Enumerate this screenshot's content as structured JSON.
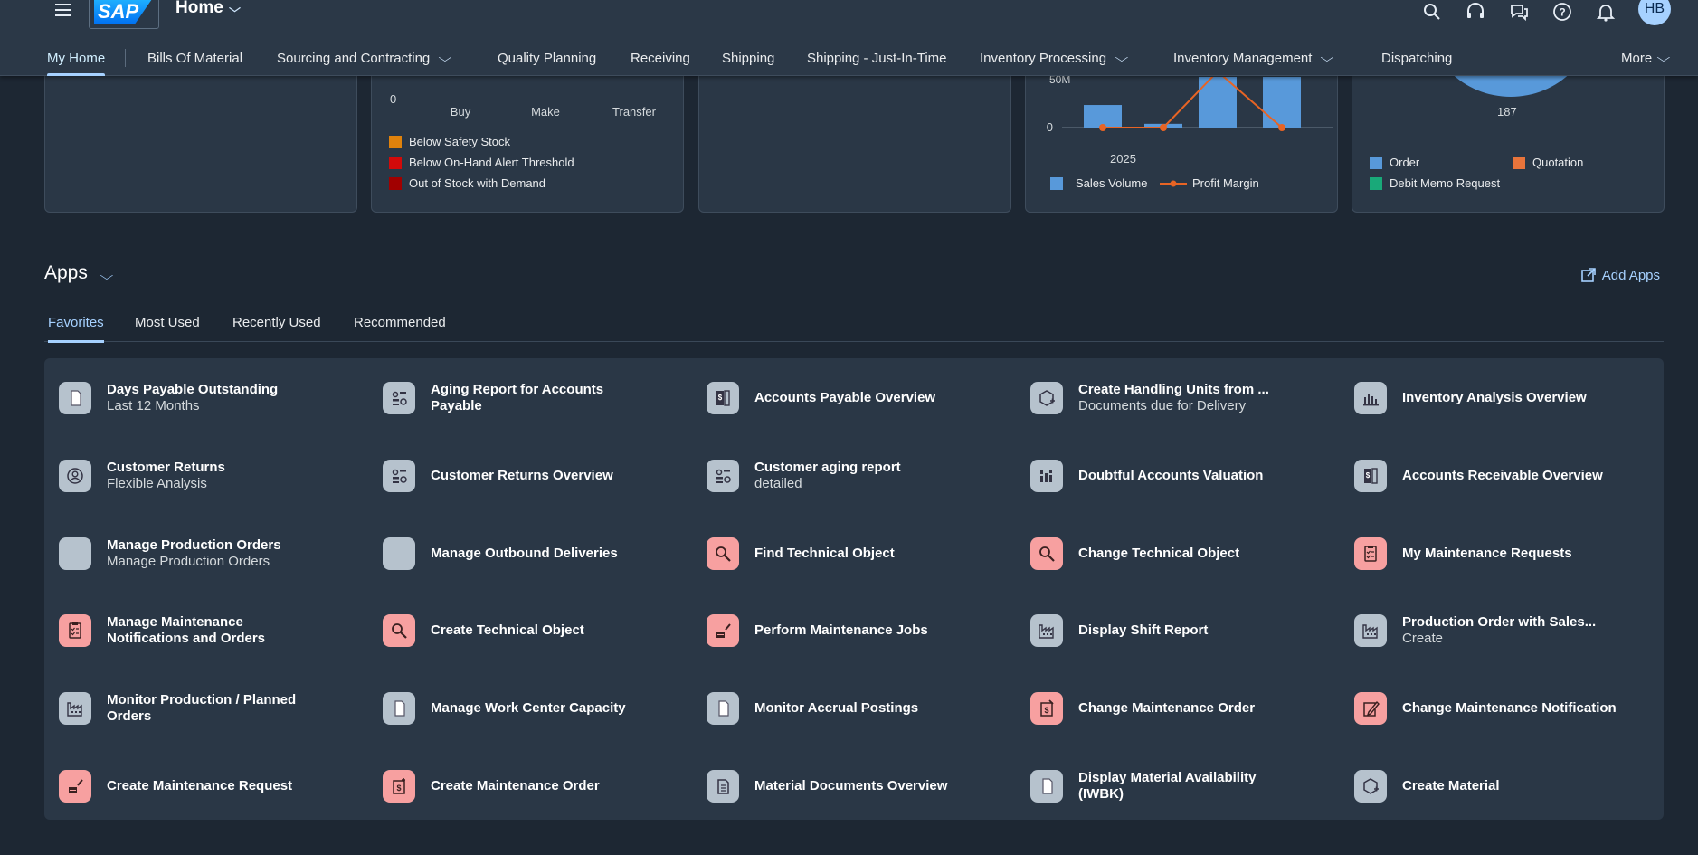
{
  "shell": {
    "logo": "SAP",
    "title": "Home",
    "avatar_initials": "HB",
    "icons": [
      "search-icon",
      "headset-icon",
      "chat-icon",
      "help-icon",
      "bell-icon"
    ]
  },
  "nav": {
    "items": [
      {
        "label": "My Home"
      },
      {
        "label": "Bills Of Material"
      },
      {
        "label": "Sourcing and Contracting"
      },
      {
        "label": "Quality Planning"
      },
      {
        "label": "Receiving"
      },
      {
        "label": "Shipping"
      },
      {
        "label": "Shipping - Just-In-Time"
      },
      {
        "label": "Inventory Processing"
      },
      {
        "label": "Inventory Management"
      },
      {
        "label": "Dispatching"
      },
      {
        "label": "More"
      }
    ]
  },
  "cards": {
    "stock_chart": {
      "y_tick": "0",
      "categories": [
        "Buy",
        "Make",
        "Transfer"
      ],
      "legend": [
        {
          "label": "Below Safety Stock",
          "color": "#e0820c"
        },
        {
          "label": "Below On-Hand Alert Threshold",
          "color": "#d20a0a"
        },
        {
          "label": "Out of Stock with Demand",
          "color": "#a10000"
        }
      ]
    },
    "sales_chart": {
      "y_ticks": [
        "50M",
        "0"
      ],
      "x_label": "2025",
      "legend": [
        {
          "label": "Sales Volume",
          "color": "#5899da"
        },
        {
          "label": "Profit Margin",
          "color": "#e86424"
        }
      ]
    },
    "pie_chart": {
      "value_label": "187",
      "legend": [
        {
          "label": "Order",
          "color": "#5899da"
        },
        {
          "label": "Quotation",
          "color": "#e8743b"
        },
        {
          "label": "Debit Memo Request",
          "color": "#19a979"
        }
      ]
    }
  },
  "chart_data": [
    {
      "type": "bar",
      "categories": [
        "Buy",
        "Make",
        "Transfer"
      ],
      "series": [
        {
          "name": "Below Safety Stock",
          "values": [
            0,
            0,
            0
          ]
        },
        {
          "name": "Below On-Hand Alert Threshold",
          "values": [
            0,
            0,
            0
          ]
        },
        {
          "name": "Out of Stock with Demand",
          "values": [
            0,
            0,
            0
          ]
        }
      ],
      "ylim": [
        0,
        0
      ]
    },
    {
      "type": "bar",
      "x": [
        "2025",
        "",
        "",
        ""
      ],
      "series": [
        {
          "name": "Sales Volume",
          "values": [
            24000000,
            4000000,
            55000000,
            55000000
          ]
        },
        {
          "name": "Profit Margin",
          "values": [
            0,
            0,
            60000000,
            0
          ]
        }
      ],
      "ylim": [
        0,
        50000000
      ]
    },
    {
      "type": "pie",
      "categories": [
        "Order",
        "Quotation",
        "Debit Memo Request"
      ],
      "values": [
        187
      ],
      "title": ""
    }
  ],
  "apps_section": {
    "title": "Apps",
    "add_apps": "Add Apps",
    "tabs": [
      "Favorites",
      "Most Used",
      "Recently Used",
      "Recommended"
    ],
    "apps": [
      {
        "title": "Days Payable Outstanding",
        "subtitle": "Last 12 Months",
        "icon": "document-icon",
        "color": "gray"
      },
      {
        "title": "Aging Report for Accounts Payable",
        "subtitle": "",
        "icon": "aging-report-icon",
        "color": "gray"
      },
      {
        "title": "Accounts Payable Overview",
        "subtitle": "",
        "icon": "ledger-icon",
        "color": "gray"
      },
      {
        "title": "Create Handling Units from ...",
        "subtitle": "Documents due for Delivery",
        "icon": "package-add-icon",
        "color": "gray"
      },
      {
        "title": "Inventory Analysis Overview",
        "subtitle": "",
        "icon": "bar-chart-icon",
        "color": "gray"
      },
      {
        "title": "Customer Returns",
        "subtitle": "Flexible Analysis",
        "icon": "customer-icon",
        "color": "gray"
      },
      {
        "title": "Customer Returns Overview",
        "subtitle": "",
        "icon": "aging-report-icon",
        "color": "gray"
      },
      {
        "title": "Customer aging report",
        "subtitle": "detailed",
        "icon": "aging-report-icon",
        "color": "gray"
      },
      {
        "title": "Doubtful Accounts Valuation",
        "subtitle": "",
        "icon": "column-chart-icon",
        "color": "gray"
      },
      {
        "title": "Accounts Receivable Overview",
        "subtitle": "",
        "icon": "ledger-icon",
        "color": "gray"
      },
      {
        "title": "Manage Production Orders",
        "subtitle": "Manage Production Orders",
        "icon": "blank-icon",
        "color": "gray"
      },
      {
        "title": "Manage Outbound Deliveries",
        "subtitle": "",
        "icon": "blank-icon",
        "color": "gray"
      },
      {
        "title": "Find Technical Object",
        "subtitle": "",
        "icon": "search-object-icon",
        "color": "red"
      },
      {
        "title": "Change Technical Object",
        "subtitle": "",
        "icon": "search-object-icon",
        "color": "red"
      },
      {
        "title": "My Maintenance Requests",
        "subtitle": "",
        "icon": "checklist-icon",
        "color": "red"
      },
      {
        "title": "Manage Maintenance Notifications and Orders",
        "subtitle": "",
        "icon": "checklist-icon",
        "color": "red"
      },
      {
        "title": "Create Technical Object",
        "subtitle": "",
        "icon": "search-object-icon",
        "color": "red"
      },
      {
        "title": "Perform Maintenance Jobs",
        "subtitle": "",
        "icon": "maintenance-icon",
        "color": "red"
      },
      {
        "title": "Display Shift Report",
        "subtitle": "",
        "icon": "factory-icon",
        "color": "gray"
      },
      {
        "title": "Production Order with Sales...",
        "subtitle": "Create",
        "icon": "factory-icon",
        "color": "gray"
      },
      {
        "title": "Monitor Production / Planned Orders",
        "subtitle": "",
        "icon": "factory-icon",
        "color": "gray"
      },
      {
        "title": "Manage Work Center Capacity",
        "subtitle": "",
        "icon": "document-icon",
        "color": "gray"
      },
      {
        "title": "Monitor Accrual Postings",
        "subtitle": "",
        "icon": "document-icon",
        "color": "gray"
      },
      {
        "title": "Change Maintenance Order",
        "subtitle": "",
        "icon": "order-edit-icon",
        "color": "red"
      },
      {
        "title": "Change Maintenance Notification",
        "subtitle": "",
        "icon": "edit-icon",
        "color": "red"
      },
      {
        "title": "Create Maintenance Request",
        "subtitle": "",
        "icon": "maintenance-icon",
        "color": "red"
      },
      {
        "title": "Create Maintenance Order",
        "subtitle": "",
        "icon": "order-add-icon",
        "color": "red"
      },
      {
        "title": "Material Documents Overview",
        "subtitle": "",
        "icon": "documents-icon",
        "color": "gray"
      },
      {
        "title": "Display Material Availability (IWBK)",
        "subtitle": "",
        "icon": "document-icon",
        "color": "gray"
      },
      {
        "title": "Create Material",
        "subtitle": "",
        "icon": "package-add-icon",
        "color": "gray"
      }
    ]
  }
}
